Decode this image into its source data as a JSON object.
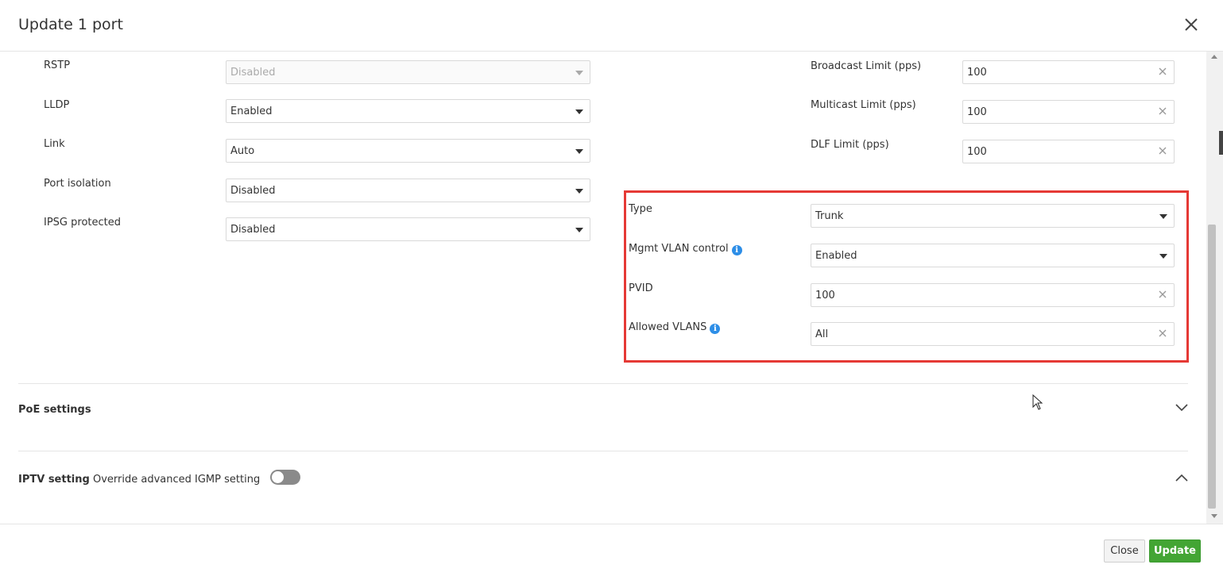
{
  "dialog": {
    "title": "Update 1 port"
  },
  "left_fields": [
    {
      "label": "RSTP",
      "value": "Disabled"
    },
    {
      "label": "LLDP",
      "value": "Enabled"
    },
    {
      "label": "Link",
      "value": "Auto"
    },
    {
      "label": "Port isolation",
      "value": "Disabled"
    },
    {
      "label": "IPSG protected",
      "value": "Disabled"
    }
  ],
  "limit_fields": [
    {
      "label": "Broadcast Limit (pps)",
      "value": "100"
    },
    {
      "label": "Multicast Limit (pps)",
      "value": "100"
    },
    {
      "label": "DLF Limit (pps)",
      "value": "100"
    }
  ],
  "vlan_fields": [
    {
      "label": "Type",
      "value": "Trunk"
    },
    {
      "label": "Mgmt VLAN control",
      "value": "Enabled"
    },
    {
      "label": "PVID",
      "value": "100"
    },
    {
      "label": "Allowed VLANS",
      "value": "All"
    }
  ],
  "poe": {
    "title": "PoE settings"
  },
  "iptv": {
    "title": "IPTV setting",
    "override_label": "Override advanced IGMP setting",
    "override_enabled": false
  },
  "footer": {
    "close_label": "Close",
    "update_label": "Update"
  },
  "colors": {
    "highlight": "#e53935",
    "update_button": "#43a534",
    "info_icon": "#2d8ee7"
  }
}
